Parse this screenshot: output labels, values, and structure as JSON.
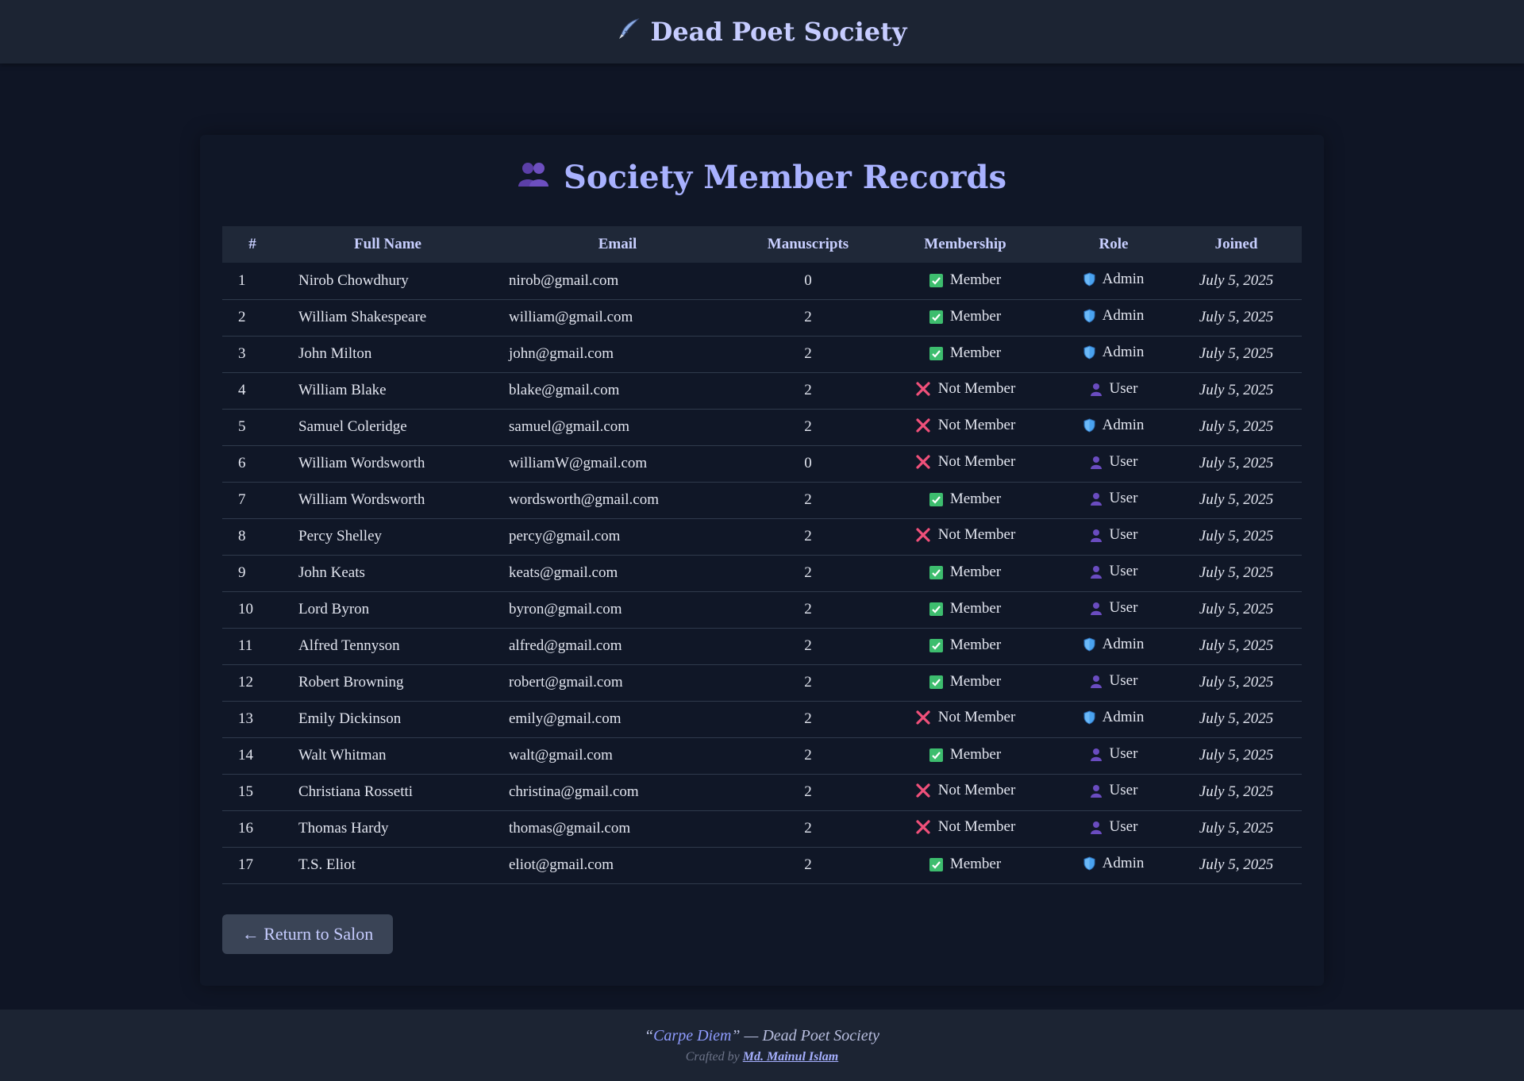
{
  "header": {
    "title": "Dead Poet Society",
    "icon": "quill-pen-icon"
  },
  "page": {
    "title": "Society Member Records",
    "icon": "members-icon"
  },
  "table": {
    "columns": [
      "#",
      "Full Name",
      "Email",
      "Manuscripts",
      "Membership",
      "Role",
      "Joined"
    ],
    "rows": [
      {
        "num": "1",
        "name": "Nirob Chowdhury",
        "email": "nirob@gmail.com",
        "manuscripts": "0",
        "member": true,
        "membership": "Member",
        "role": "Admin",
        "joined": "July 5, 2025"
      },
      {
        "num": "2",
        "name": "William Shakespeare",
        "email": "william@gmail.com",
        "manuscripts": "2",
        "member": true,
        "membership": "Member",
        "role": "Admin",
        "joined": "July 5, 2025"
      },
      {
        "num": "3",
        "name": "John Milton",
        "email": "john@gmail.com",
        "manuscripts": "2",
        "member": true,
        "membership": "Member",
        "role": "Admin",
        "joined": "July 5, 2025"
      },
      {
        "num": "4",
        "name": "William Blake",
        "email": "blake@gmail.com",
        "manuscripts": "2",
        "member": false,
        "membership": "Not Member",
        "role": "User",
        "joined": "July 5, 2025"
      },
      {
        "num": "5",
        "name": "Samuel Coleridge",
        "email": "samuel@gmail.com",
        "manuscripts": "2",
        "member": false,
        "membership": "Not Member",
        "role": "Admin",
        "joined": "July 5, 2025"
      },
      {
        "num": "6",
        "name": "William Wordsworth",
        "email": "williamW@gmail.com",
        "manuscripts": "0",
        "member": false,
        "membership": "Not Member",
        "role": "User",
        "joined": "July 5, 2025"
      },
      {
        "num": "7",
        "name": "William Wordsworth",
        "email": "wordsworth@gmail.com",
        "manuscripts": "2",
        "member": true,
        "membership": "Member",
        "role": "User",
        "joined": "July 5, 2025"
      },
      {
        "num": "8",
        "name": "Percy Shelley",
        "email": "percy@gmail.com",
        "manuscripts": "2",
        "member": false,
        "membership": "Not Member",
        "role": "User",
        "joined": "July 5, 2025"
      },
      {
        "num": "9",
        "name": "John Keats",
        "email": "keats@gmail.com",
        "manuscripts": "2",
        "member": true,
        "membership": "Member",
        "role": "User",
        "joined": "July 5, 2025"
      },
      {
        "num": "10",
        "name": "Lord Byron",
        "email": "byron@gmail.com",
        "manuscripts": "2",
        "member": true,
        "membership": "Member",
        "role": "User",
        "joined": "July 5, 2025"
      },
      {
        "num": "11",
        "name": "Alfred Tennyson",
        "email": "alfred@gmail.com",
        "manuscripts": "2",
        "member": true,
        "membership": "Member",
        "role": "Admin",
        "joined": "July 5, 2025"
      },
      {
        "num": "12",
        "name": "Robert Browning",
        "email": "robert@gmail.com",
        "manuscripts": "2",
        "member": true,
        "membership": "Member",
        "role": "User",
        "joined": "July 5, 2025"
      },
      {
        "num": "13",
        "name": "Emily Dickinson",
        "email": "emily@gmail.com",
        "manuscripts": "2",
        "member": false,
        "membership": "Not Member",
        "role": "Admin",
        "joined": "July 5, 2025"
      },
      {
        "num": "14",
        "name": "Walt Whitman",
        "email": "walt@gmail.com",
        "manuscripts": "2",
        "member": true,
        "membership": "Member",
        "role": "User",
        "joined": "July 5, 2025"
      },
      {
        "num": "15",
        "name": "Christiana Rossetti",
        "email": "christina@gmail.com",
        "manuscripts": "2",
        "member": false,
        "membership": "Not Member",
        "role": "User",
        "joined": "July 5, 2025"
      },
      {
        "num": "16",
        "name": "Thomas Hardy",
        "email": "thomas@gmail.com",
        "manuscripts": "2",
        "member": false,
        "membership": "Not Member",
        "role": "User",
        "joined": "July 5, 2025"
      },
      {
        "num": "17",
        "name": "T.S. Eliot",
        "email": "eliot@gmail.com",
        "manuscripts": "2",
        "member": true,
        "membership": "Member",
        "role": "Admin",
        "joined": "July 5, 2025"
      }
    ]
  },
  "actions": {
    "return_label": "← Return to Salon"
  },
  "footer": {
    "quote_open": "“",
    "quote_text": "Carpe Diem",
    "quote_rest": "” — Dead Poet Society",
    "credit_prefix": "Crafted by ",
    "credit_author": "Md. Mainul Islam"
  },
  "colors": {
    "background": "#0f1525",
    "bar": "#1c2433",
    "accent": "#a9b2ff",
    "member_check": "#3dbd6e",
    "not_member_x": "#f0507a",
    "admin_shield": "#4aa3f0",
    "user_icon": "#6a4cc0"
  }
}
